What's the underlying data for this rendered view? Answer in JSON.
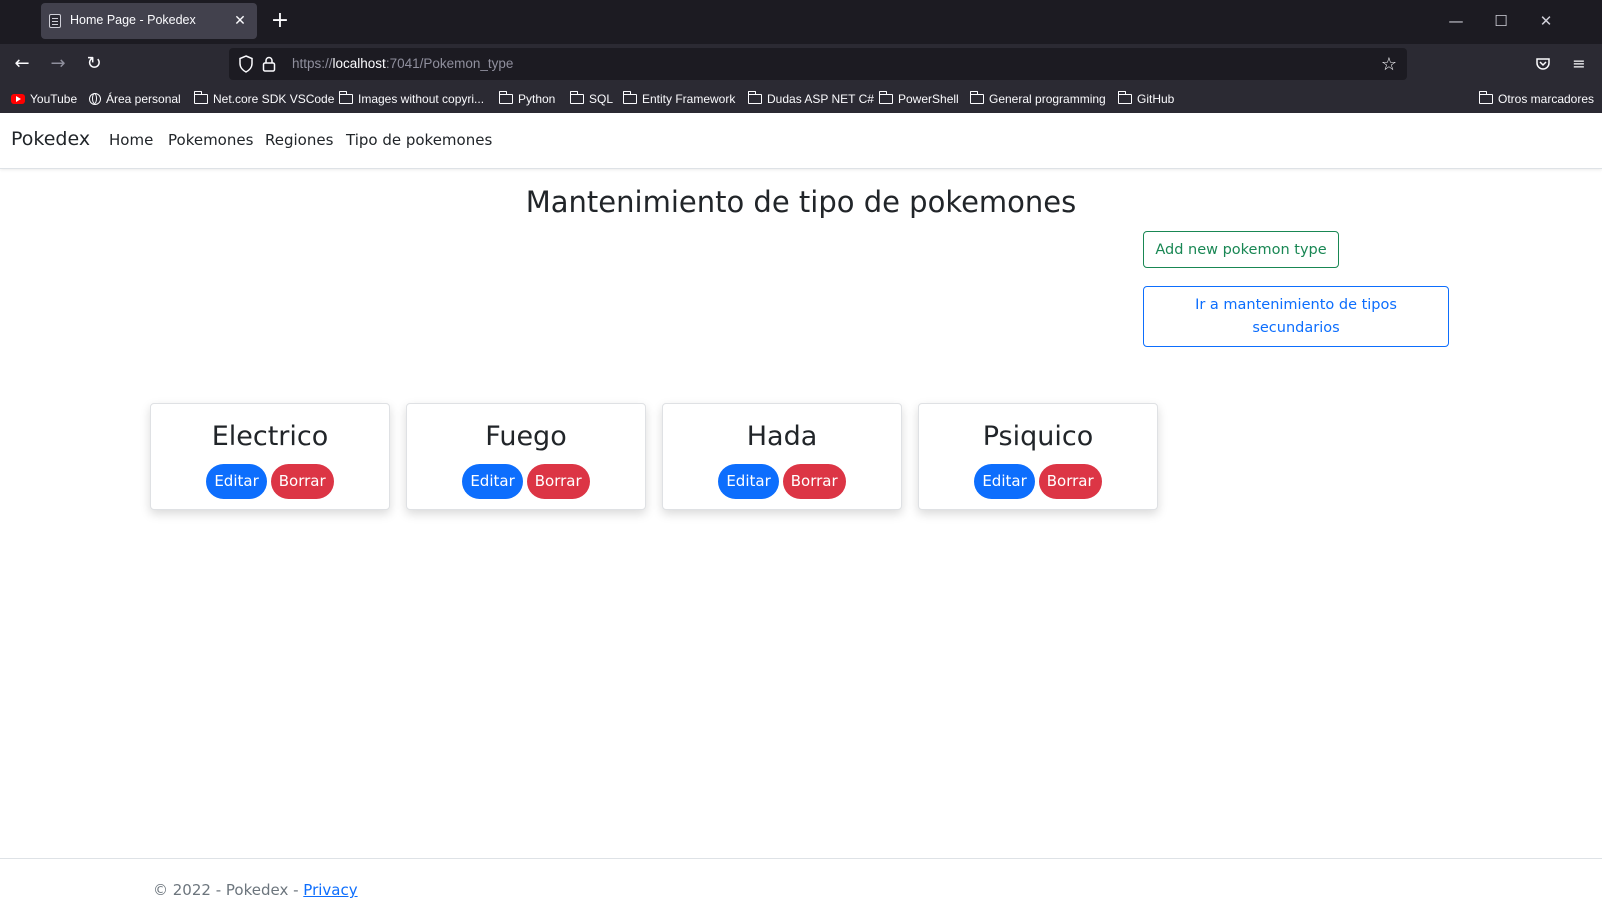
{
  "browser": {
    "tab_title": "Home Page - Pokedex",
    "url_prefix": "https://",
    "url_host": "localhost",
    "url_path": ":7041/Pokemon_type",
    "bookmarks": [
      {
        "label": "YouTube",
        "icon": "youtube-icon"
      },
      {
        "label": "Área personal",
        "icon": "globe-icon"
      },
      {
        "label": "Net.core SDK VSCode",
        "icon": "folder-icon"
      },
      {
        "label": "Images without copyri...",
        "icon": "folder-icon"
      },
      {
        "label": "Python",
        "icon": "folder-icon"
      },
      {
        "label": "SQL",
        "icon": "folder-icon"
      },
      {
        "label": "Entity Framework",
        "icon": "folder-icon"
      },
      {
        "label": "Dudas ASP NET C#",
        "icon": "folder-icon"
      },
      {
        "label": "PowerShell",
        "icon": "folder-icon"
      },
      {
        "label": "General programming",
        "icon": "folder-icon"
      },
      {
        "label": "GitHub",
        "icon": "folder-icon"
      }
    ],
    "other_bookmarks": "Otros marcadores"
  },
  "navbar": {
    "brand": "Pokedex",
    "links": [
      "Home",
      "Pokemones",
      "Regiones",
      "Tipo de pokemones"
    ]
  },
  "main": {
    "title": "Mantenimiento de tipo de pokemones",
    "add_button": "Add new pokemon type",
    "secondary_button": "Ir a mantenimiento de tipos secundarios",
    "edit_label": "Editar",
    "delete_label": "Borrar",
    "types": [
      "Electrico",
      "Fuego",
      "Hada",
      "Psiquico"
    ]
  },
  "footer": {
    "copyright": "© 2022 - Pokedex - ",
    "privacy": "Privacy"
  },
  "colors": {
    "primary": "#0d6efd",
    "danger": "#dc3545",
    "success": "#198754",
    "chrome_dark": "#1c1b22",
    "chrome_toolbar": "#2b2a33"
  }
}
